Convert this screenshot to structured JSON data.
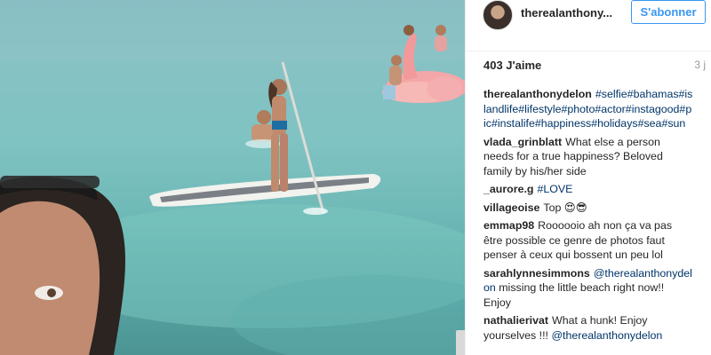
{
  "post": {
    "username": "therealanthony...",
    "follow_label": "S'abonner",
    "likes": "403 J'aime",
    "time": "3 j"
  },
  "caption": {
    "author": "therealanthonydelon",
    "text": "#selfie#bahamas#islandlife#lifestyle#photo#actor#instagood#pic#instalife#happiness#holidays#sea#sun"
  },
  "comments": [
    {
      "author": "vlada_grinblatt",
      "text": "What else a person needs for a true happiness? Beloved family by his/her side"
    },
    {
      "author": "_aurore.g",
      "text": "#LOVE"
    },
    {
      "author": "villageoise",
      "text": "Top 😍😎"
    },
    {
      "author": "emmap98",
      "text": "Roooooio ah non ça va pas être possible ce genre de photos faut penser à ceux qui bossent un peu lol"
    },
    {
      "author": "sarahlynnesimmons",
      "mention": "@therealanthonydelon",
      "text": " missing the little beach right now!! Enjoy"
    },
    {
      "author": "nathalierivat",
      "text": "What a hunk! Enjoy yourselves !!! ",
      "mention": "@therealanthonydelon"
    }
  ]
}
